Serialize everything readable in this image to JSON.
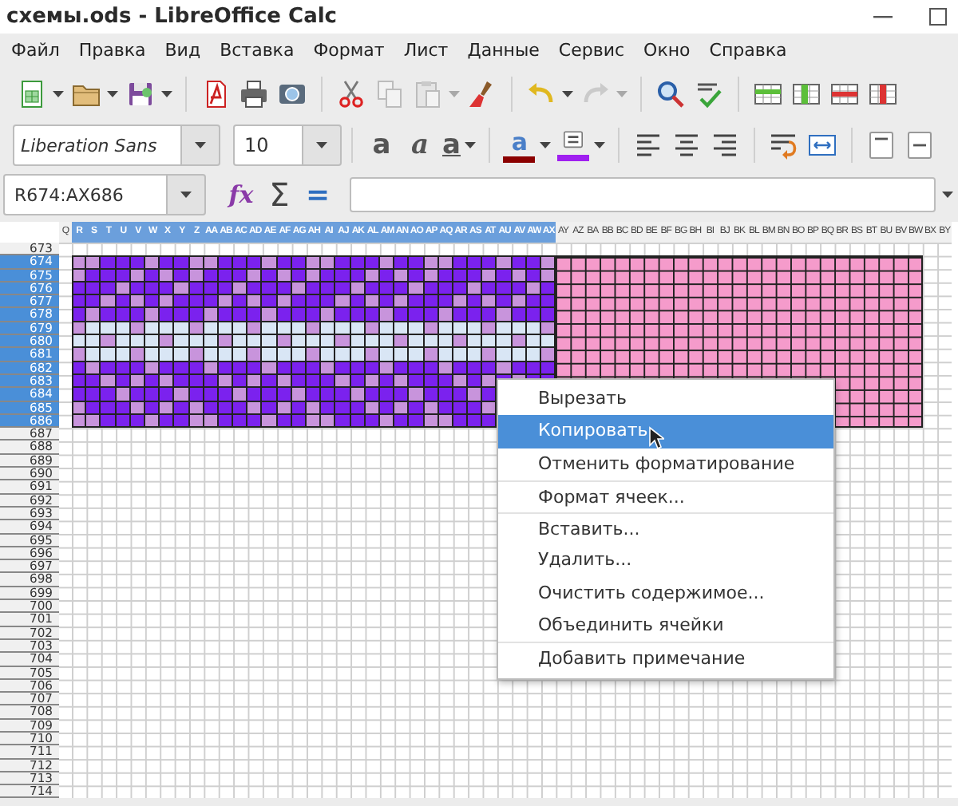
{
  "window": {
    "title": "схемы.ods - LibreOffice Calc"
  },
  "menu": [
    "Файл",
    "Правка",
    "Вид",
    "Вставка",
    "Формат",
    "Лист",
    "Данные",
    "Сервис",
    "Окно",
    "Справка"
  ],
  "standard_toolbar": [
    {
      "kind": "new",
      "disabled": false,
      "dropdown": true,
      "separator_before": false
    },
    {
      "kind": "open",
      "disabled": false,
      "dropdown": true,
      "separator_before": false
    },
    {
      "kind": "save",
      "disabled": false,
      "dropdown": true,
      "separator_before": false
    },
    {
      "kind": "pdf",
      "disabled": false,
      "dropdown": false,
      "separator_before": true
    },
    {
      "kind": "print",
      "disabled": false,
      "dropdown": false,
      "separator_before": false
    },
    {
      "kind": "preview",
      "disabled": false,
      "dropdown": false,
      "separator_before": false
    },
    {
      "kind": "cut",
      "disabled": false,
      "dropdown": false,
      "separator_before": true
    },
    {
      "kind": "copy",
      "disabled": true,
      "dropdown": false,
      "separator_before": false
    },
    {
      "kind": "paste",
      "disabled": true,
      "dropdown": true,
      "separator_before": false
    },
    {
      "kind": "clone",
      "disabled": false,
      "dropdown": false,
      "separator_before": false
    },
    {
      "kind": "undo",
      "disabled": false,
      "dropdown": true,
      "separator_before": true
    },
    {
      "kind": "redo",
      "disabled": true,
      "dropdown": true,
      "separator_before": false
    },
    {
      "kind": "find",
      "disabled": false,
      "dropdown": false,
      "separator_before": true
    },
    {
      "kind": "spelling",
      "disabled": false,
      "dropdown": false,
      "separator_before": false
    },
    {
      "kind": "insert-rows",
      "disabled": false,
      "dropdown": false,
      "separator_before": true
    },
    {
      "kind": "insert-columns",
      "disabled": false,
      "dropdown": false,
      "separator_before": false
    },
    {
      "kind": "delete-rows",
      "disabled": false,
      "dropdown": false,
      "separator_before": false
    },
    {
      "kind": "delete-columns",
      "disabled": false,
      "dropdown": false,
      "separator_before": false
    }
  ],
  "formatting_toolbar": {
    "font_name": "Liberation Sans",
    "font_size": "10",
    "buttons": [
      {
        "kind": "bold",
        "label": "a",
        "dropdown": false,
        "separator_before": true
      },
      {
        "kind": "italic",
        "label": "a",
        "dropdown": false,
        "separator_before": false
      },
      {
        "kind": "underline",
        "label": "a",
        "dropdown": true,
        "separator_before": false
      },
      {
        "kind": "font-color",
        "label": "a",
        "color": "#8b0000",
        "dropdown": true,
        "separator_before": true
      },
      {
        "kind": "highlight",
        "color": "#a020f0",
        "dropdown": true,
        "separator_before": false
      },
      {
        "kind": "align-left",
        "dropdown": false,
        "separator_before": true
      },
      {
        "kind": "align-center",
        "dropdown": false,
        "separator_before": false
      },
      {
        "kind": "align-right",
        "dropdown": false,
        "separator_before": false
      },
      {
        "kind": "wrap",
        "dropdown": false,
        "separator_before": true
      },
      {
        "kind": "merge",
        "dropdown": false,
        "separator_before": false
      },
      {
        "kind": "align-top",
        "dropdown": false,
        "separator_before": true
      },
      {
        "kind": "align-middle",
        "dropdown": false,
        "separator_before": false
      }
    ]
  },
  "formula_bar": {
    "name_box": "R674:AX686",
    "buttons": [
      "fx",
      "Σ",
      "="
    ]
  },
  "sheet": {
    "columns": [
      {
        "label": "Q",
        "selected": false
      },
      {
        "label": "R",
        "selected": true
      },
      {
        "label": "S",
        "selected": true
      },
      {
        "label": "T",
        "selected": true
      },
      {
        "label": "U",
        "selected": true
      },
      {
        "label": "V",
        "selected": true
      },
      {
        "label": "W",
        "selected": true
      },
      {
        "label": "X",
        "selected": true
      },
      {
        "label": "Y",
        "selected": true
      },
      {
        "label": "Z",
        "selected": true
      },
      {
        "label": "AA",
        "selected": true
      },
      {
        "label": "AB",
        "selected": true
      },
      {
        "label": "AC",
        "selected": true
      },
      {
        "label": "AD",
        "selected": true
      },
      {
        "label": "AE",
        "selected": true
      },
      {
        "label": "AF",
        "selected": true
      },
      {
        "label": "AG",
        "selected": true
      },
      {
        "label": "AH",
        "selected": true
      },
      {
        "label": "AI",
        "selected": true
      },
      {
        "label": "AJ",
        "selected": true
      },
      {
        "label": "AK",
        "selected": true
      },
      {
        "label": "AL",
        "selected": true
      },
      {
        "label": "AM",
        "selected": true
      },
      {
        "label": "AN",
        "selected": true
      },
      {
        "label": "AO",
        "selected": true
      },
      {
        "label": "AP",
        "selected": true
      },
      {
        "label": "AQ",
        "selected": true
      },
      {
        "label": "AR",
        "selected": true
      },
      {
        "label": "AS",
        "selected": true
      },
      {
        "label": "AT",
        "selected": true
      },
      {
        "label": "AU",
        "selected": true
      },
      {
        "label": "AV",
        "selected": true
      },
      {
        "label": "AW",
        "selected": true
      },
      {
        "label": "AX",
        "selected": true
      },
      {
        "label": "AY",
        "selected": false
      },
      {
        "label": "AZ",
        "selected": false
      },
      {
        "label": "BA",
        "selected": false
      },
      {
        "label": "BB",
        "selected": false
      },
      {
        "label": "BC",
        "selected": false
      },
      {
        "label": "BD",
        "selected": false
      },
      {
        "label": "BE",
        "selected": false
      },
      {
        "label": "BF",
        "selected": false
      },
      {
        "label": "BG",
        "selected": false
      },
      {
        "label": "BH",
        "selected": false
      },
      {
        "label": "BI",
        "selected": false
      },
      {
        "label": "BJ",
        "selected": false
      },
      {
        "label": "BK",
        "selected": false
      },
      {
        "label": "BL",
        "selected": false
      },
      {
        "label": "BM",
        "selected": false
      },
      {
        "label": "BN",
        "selected": false
      },
      {
        "label": "BO",
        "selected": false
      },
      {
        "label": "BP",
        "selected": false
      },
      {
        "label": "BQ",
        "selected": false
      },
      {
        "label": "BR",
        "selected": false
      },
      {
        "label": "BS",
        "selected": false
      },
      {
        "label": "BT",
        "selected": false
      },
      {
        "label": "BU",
        "selected": false
      },
      {
        "label": "BV",
        "selected": false
      },
      {
        "label": "BW",
        "selected": false
      },
      {
        "label": "BX",
        "selected": false
      },
      {
        "label": "BY",
        "selected": false
      }
    ],
    "rows": [
      {
        "label": "673",
        "selected": false
      },
      {
        "label": "674",
        "selected": true
      },
      {
        "label": "675",
        "selected": true
      },
      {
        "label": "676",
        "selected": true
      },
      {
        "label": "677",
        "selected": true
      },
      {
        "label": "678",
        "selected": true
      },
      {
        "label": "679",
        "selected": true
      },
      {
        "label": "680",
        "selected": true
      },
      {
        "label": "681",
        "selected": true
      },
      {
        "label": "682",
        "selected": true
      },
      {
        "label": "683",
        "selected": true
      },
      {
        "label": "684",
        "selected": true
      },
      {
        "label": "685",
        "selected": true
      },
      {
        "label": "686",
        "selected": true
      },
      {
        "label": "687",
        "selected": false
      },
      {
        "label": "688",
        "selected": false
      },
      {
        "label": "689",
        "selected": false
      },
      {
        "label": "690",
        "selected": false
      },
      {
        "label": "691",
        "selected": false
      },
      {
        "label": "692",
        "selected": false
      },
      {
        "label": "693",
        "selected": false
      },
      {
        "label": "694",
        "selected": false
      },
      {
        "label": "695",
        "selected": false
      },
      {
        "label": "696",
        "selected": false
      },
      {
        "label": "697",
        "selected": false
      },
      {
        "label": "698",
        "selected": false
      },
      {
        "label": "699",
        "selected": false
      },
      {
        "label": "700",
        "selected": false
      },
      {
        "label": "701",
        "selected": false
      },
      {
        "label": "702",
        "selected": false
      },
      {
        "label": "703",
        "selected": false
      },
      {
        "label": "704",
        "selected": false
      },
      {
        "label": "705",
        "selected": false
      },
      {
        "label": "706",
        "selected": false
      },
      {
        "label": "707",
        "selected": false
      },
      {
        "label": "708",
        "selected": false
      },
      {
        "label": "709",
        "selected": false
      },
      {
        "label": "710",
        "selected": false
      },
      {
        "label": "711",
        "selected": false
      },
      {
        "label": "712",
        "selected": false
      },
      {
        "label": "713",
        "selected": false
      },
      {
        "label": "714",
        "selected": false
      }
    ]
  },
  "pattern": {
    "rows": [
      [
        {
          "color": "#c894dc"
        },
        {
          "color": "#c894dc"
        },
        {
          "color": "#7b22ee"
        },
        {
          "color": "#7b22ee"
        },
        {
          "color": "#7b22ee"
        },
        {
          "color": "#c894dc"
        },
        {
          "color": "#7b22ee"
        },
        {
          "color": "#7b22ee"
        },
        {
          "color": "#c894dc"
        },
        {
          "color": "#c894dc"
        },
        {
          "color": "#7b22ee"
        },
        {
          "color": "#7b22ee"
        },
        {
          "color": "#7b22ee"
        },
        {
          "color": "#c894dc"
        },
        {
          "color": "#7b22ee"
        },
        {
          "color": "#7b22ee"
        },
        {
          "color": "#c894dc"
        },
        {
          "color": "#c894dc"
        },
        {
          "color": "#7b22ee"
        },
        {
          "color": "#7b22ee"
        },
        {
          "color": "#7b22ee"
        },
        {
          "color": "#c894dc"
        },
        {
          "color": "#7b22ee"
        },
        {
          "color": "#7b22ee"
        },
        {
          "color": "#c894dc"
        },
        {
          "color": "#c894dc"
        },
        {
          "color": "#7b22ee"
        },
        {
          "color": "#7b22ee"
        },
        {
          "color": "#7b22ee"
        },
        {
          "color": "#c894dc"
        },
        {
          "color": "#7b22ee"
        },
        {
          "color": "#7b22ee"
        },
        {
          "color": "#c894dc"
        }
      ],
      [
        {
          "color": "#c894dc"
        },
        {
          "color": "#7b22ee"
        },
        {
          "color": "#7b22ee"
        },
        {
          "color": "#7b22ee"
        },
        {
          "color": "#c894dc"
        },
        {
          "color": "#7b22ee"
        },
        {
          "color": "#c894dc"
        },
        {
          "color": "#7b22ee"
        },
        {
          "color": "#c894dc"
        },
        {
          "color": "#7b22ee"
        },
        {
          "color": "#7b22ee"
        },
        {
          "color": "#7b22ee"
        },
        {
          "color": "#c894dc"
        },
        {
          "color": "#7b22ee"
        },
        {
          "color": "#c894dc"
        },
        {
          "color": "#7b22ee"
        },
        {
          "color": "#c894dc"
        },
        {
          "color": "#7b22ee"
        },
        {
          "color": "#7b22ee"
        },
        {
          "color": "#7b22ee"
        },
        {
          "color": "#c894dc"
        },
        {
          "color": "#7b22ee"
        },
        {
          "color": "#c894dc"
        },
        {
          "color": "#7b22ee"
        },
        {
          "color": "#c894dc"
        },
        {
          "color": "#7b22ee"
        },
        {
          "color": "#7b22ee"
        },
        {
          "color": "#7b22ee"
        },
        {
          "color": "#c894dc"
        },
        {
          "color": "#7b22ee"
        },
        {
          "color": "#c894dc"
        },
        {
          "color": "#7b22ee"
        },
        {
          "color": "#c894dc"
        }
      ],
      [
        {
          "color": "#7b22ee"
        },
        {
          "color": "#7b22ee"
        },
        {
          "color": "#7b22ee"
        },
        {
          "color": "#c894dc"
        },
        {
          "color": "#7b22ee"
        },
        {
          "color": "#7b22ee"
        },
        {
          "color": "#7b22ee"
        },
        {
          "color": "#c894dc"
        },
        {
          "color": "#7b22ee"
        },
        {
          "color": "#7b22ee"
        },
        {
          "color": "#7b22ee"
        },
        {
          "color": "#c894dc"
        },
        {
          "color": "#7b22ee"
        },
        {
          "color": "#7b22ee"
        },
        {
          "color": "#7b22ee"
        },
        {
          "color": "#c894dc"
        },
        {
          "color": "#7b22ee"
        },
        {
          "color": "#7b22ee"
        },
        {
          "color": "#7b22ee"
        },
        {
          "color": "#c894dc"
        },
        {
          "color": "#7b22ee"
        },
        {
          "color": "#7b22ee"
        },
        {
          "color": "#7b22ee"
        },
        {
          "color": "#c894dc"
        },
        {
          "color": "#7b22ee"
        },
        {
          "color": "#7b22ee"
        },
        {
          "color": "#7b22ee"
        },
        {
          "color": "#c894dc"
        },
        {
          "color": "#7b22ee"
        },
        {
          "color": "#7b22ee"
        },
        {
          "color": "#7b22ee"
        },
        {
          "color": "#c894dc"
        },
        {
          "color": "#7b22ee"
        }
      ],
      [
        {
          "color": "#7b22ee"
        },
        {
          "color": "#7b22ee"
        },
        {
          "color": "#c894dc"
        },
        {
          "color": "#7b22ee"
        },
        {
          "color": "#c894dc"
        },
        {
          "color": "#7b22ee"
        },
        {
          "color": "#c894dc"
        },
        {
          "color": "#7b22ee"
        },
        {
          "color": "#7b22ee"
        },
        {
          "color": "#7b22ee"
        },
        {
          "color": "#c894dc"
        },
        {
          "color": "#7b22ee"
        },
        {
          "color": "#c894dc"
        },
        {
          "color": "#7b22ee"
        },
        {
          "color": "#c894dc"
        },
        {
          "color": "#7b22ee"
        },
        {
          "color": "#7b22ee"
        },
        {
          "color": "#7b22ee"
        },
        {
          "color": "#c894dc"
        },
        {
          "color": "#7b22ee"
        },
        {
          "color": "#c894dc"
        },
        {
          "color": "#7b22ee"
        },
        {
          "color": "#c894dc"
        },
        {
          "color": "#7b22ee"
        },
        {
          "color": "#7b22ee"
        },
        {
          "color": "#7b22ee"
        },
        {
          "color": "#c894dc"
        },
        {
          "color": "#7b22ee"
        },
        {
          "color": "#c894dc"
        },
        {
          "color": "#7b22ee"
        },
        {
          "color": "#c894dc"
        },
        {
          "color": "#7b22ee"
        },
        {
          "color": "#7b22ee"
        }
      ],
      [
        {
          "color": "#7b22ee"
        },
        {
          "color": "#c894dc"
        },
        {
          "color": "#7b22ee"
        },
        {
          "color": "#7b22ee"
        },
        {
          "color": "#7b22ee"
        },
        {
          "color": "#c894dc"
        },
        {
          "color": "#7b22ee"
        },
        {
          "color": "#7b22ee"
        },
        {
          "color": "#7b22ee"
        },
        {
          "color": "#c894dc"
        },
        {
          "color": "#7b22ee"
        },
        {
          "color": "#7b22ee"
        },
        {
          "color": "#7b22ee"
        },
        {
          "color": "#c894dc"
        },
        {
          "color": "#7b22ee"
        },
        {
          "color": "#7b22ee"
        },
        {
          "color": "#7b22ee"
        },
        {
          "color": "#c894dc"
        },
        {
          "color": "#7b22ee"
        },
        {
          "color": "#7b22ee"
        },
        {
          "color": "#7b22ee"
        },
        {
          "color": "#c894dc"
        },
        {
          "color": "#7b22ee"
        },
        {
          "color": "#7b22ee"
        },
        {
          "color": "#7b22ee"
        },
        {
          "color": "#c894dc"
        },
        {
          "color": "#7b22ee"
        },
        {
          "color": "#7b22ee"
        },
        {
          "color": "#7b22ee"
        },
        {
          "color": "#c894dc"
        },
        {
          "color": "#7b22ee"
        },
        {
          "color": "#7b22ee"
        },
        {
          "color": "#7b22ee"
        }
      ],
      [
        {
          "color": "#c894dc"
        },
        {
          "color": "#d9e6f5"
        },
        {
          "color": "#d9e6f5"
        },
        {
          "color": "#d9e6f5"
        },
        {
          "color": "#c894dc"
        },
        {
          "color": "#d9e6f5"
        },
        {
          "color": "#d9e6f5"
        },
        {
          "color": "#d9e6f5"
        },
        {
          "color": "#c894dc"
        },
        {
          "color": "#d9e6f5"
        },
        {
          "color": "#d9e6f5"
        },
        {
          "color": "#d9e6f5"
        },
        {
          "color": "#c894dc"
        },
        {
          "color": "#d9e6f5"
        },
        {
          "color": "#d9e6f5"
        },
        {
          "color": "#d9e6f5"
        },
        {
          "color": "#c894dc"
        },
        {
          "color": "#d9e6f5"
        },
        {
          "color": "#d9e6f5"
        },
        {
          "color": "#d9e6f5"
        },
        {
          "color": "#c894dc"
        },
        {
          "color": "#d9e6f5"
        },
        {
          "color": "#d9e6f5"
        },
        {
          "color": "#d9e6f5"
        },
        {
          "color": "#c894dc"
        },
        {
          "color": "#d9e6f5"
        },
        {
          "color": "#d9e6f5"
        },
        {
          "color": "#d9e6f5"
        },
        {
          "color": "#c894dc"
        },
        {
          "color": "#d9e6f5"
        },
        {
          "color": "#d9e6f5"
        },
        {
          "color": "#d9e6f5"
        },
        {
          "color": "#c894dc"
        }
      ],
      [
        {
          "color": "#d9e6f5"
        },
        {
          "color": "#d9e6f5"
        },
        {
          "color": "#c894dc"
        },
        {
          "color": "#d9e6f5"
        },
        {
          "color": "#d9e6f5"
        },
        {
          "color": "#d9e6f5"
        },
        {
          "color": "#c894dc"
        },
        {
          "color": "#d9e6f5"
        },
        {
          "color": "#d9e6f5"
        },
        {
          "color": "#d9e6f5"
        },
        {
          "color": "#c894dc"
        },
        {
          "color": "#d9e6f5"
        },
        {
          "color": "#d9e6f5"
        },
        {
          "color": "#d9e6f5"
        },
        {
          "color": "#c894dc"
        },
        {
          "color": "#d9e6f5"
        },
        {
          "color": "#d9e6f5"
        },
        {
          "color": "#d9e6f5"
        },
        {
          "color": "#c894dc"
        },
        {
          "color": "#d9e6f5"
        },
        {
          "color": "#d9e6f5"
        },
        {
          "color": "#d9e6f5"
        },
        {
          "color": "#c894dc"
        },
        {
          "color": "#d9e6f5"
        },
        {
          "color": "#d9e6f5"
        },
        {
          "color": "#d9e6f5"
        },
        {
          "color": "#c894dc"
        },
        {
          "color": "#d9e6f5"
        },
        {
          "color": "#d9e6f5"
        },
        {
          "color": "#d9e6f5"
        },
        {
          "color": "#c894dc"
        },
        {
          "color": "#d9e6f5"
        },
        {
          "color": "#d9e6f5"
        }
      ],
      [
        {
          "color": "#c894dc"
        },
        {
          "color": "#d9e6f5"
        },
        {
          "color": "#d9e6f5"
        },
        {
          "color": "#d9e6f5"
        },
        {
          "color": "#c894dc"
        },
        {
          "color": "#d9e6f5"
        },
        {
          "color": "#d9e6f5"
        },
        {
          "color": "#d9e6f5"
        },
        {
          "color": "#c894dc"
        },
        {
          "color": "#d9e6f5"
        },
        {
          "color": "#d9e6f5"
        },
        {
          "color": "#d9e6f5"
        },
        {
          "color": "#c894dc"
        },
        {
          "color": "#d9e6f5"
        },
        {
          "color": "#d9e6f5"
        },
        {
          "color": "#d9e6f5"
        },
        {
          "color": "#c894dc"
        },
        {
          "color": "#d9e6f5"
        },
        {
          "color": "#d9e6f5"
        },
        {
          "color": "#d9e6f5"
        },
        {
          "color": "#c894dc"
        },
        {
          "color": "#d9e6f5"
        },
        {
          "color": "#d9e6f5"
        },
        {
          "color": "#d9e6f5"
        },
        {
          "color": "#c894dc"
        },
        {
          "color": "#d9e6f5"
        },
        {
          "color": "#d9e6f5"
        },
        {
          "color": "#d9e6f5"
        },
        {
          "color": "#c894dc"
        },
        {
          "color": "#d9e6f5"
        },
        {
          "color": "#d9e6f5"
        },
        {
          "color": "#d9e6f5"
        },
        {
          "color": "#c894dc"
        }
      ],
      [
        {
          "color": "#7b22ee"
        },
        {
          "color": "#c894dc"
        },
        {
          "color": "#7b22ee"
        },
        {
          "color": "#7b22ee"
        },
        {
          "color": "#7b22ee"
        },
        {
          "color": "#c894dc"
        },
        {
          "color": "#7b22ee"
        },
        {
          "color": "#7b22ee"
        },
        {
          "color": "#7b22ee"
        },
        {
          "color": "#c894dc"
        },
        {
          "color": "#7b22ee"
        },
        {
          "color": "#7b22ee"
        },
        {
          "color": "#7b22ee"
        },
        {
          "color": "#c894dc"
        },
        {
          "color": "#7b22ee"
        },
        {
          "color": "#7b22ee"
        },
        {
          "color": "#7b22ee"
        },
        {
          "color": "#c894dc"
        },
        {
          "color": "#7b22ee"
        },
        {
          "color": "#7b22ee"
        },
        {
          "color": "#7b22ee"
        },
        {
          "color": "#c894dc"
        },
        {
          "color": "#7b22ee"
        },
        {
          "color": "#7b22ee"
        },
        {
          "color": "#7b22ee"
        },
        {
          "color": "#c894dc"
        },
        {
          "color": "#7b22ee"
        },
        {
          "color": "#7b22ee"
        },
        {
          "color": "#7b22ee"
        },
        {
          "color": "#c894dc"
        },
        {
          "color": "#7b22ee"
        },
        {
          "color": "#7b22ee"
        },
        {
          "color": "#7b22ee"
        }
      ],
      [
        {
          "color": "#7b22ee"
        },
        {
          "color": "#7b22ee"
        },
        {
          "color": "#c894dc"
        },
        {
          "color": "#7b22ee"
        },
        {
          "color": "#c894dc"
        },
        {
          "color": "#7b22ee"
        },
        {
          "color": "#c894dc"
        },
        {
          "color": "#7b22ee"
        },
        {
          "color": "#7b22ee"
        },
        {
          "color": "#7b22ee"
        },
        {
          "color": "#c894dc"
        },
        {
          "color": "#7b22ee"
        },
        {
          "color": "#c894dc"
        },
        {
          "color": "#7b22ee"
        },
        {
          "color": "#c894dc"
        },
        {
          "color": "#7b22ee"
        },
        {
          "color": "#7b22ee"
        },
        {
          "color": "#7b22ee"
        },
        {
          "color": "#c894dc"
        },
        {
          "color": "#7b22ee"
        },
        {
          "color": "#c894dc"
        },
        {
          "color": "#7b22ee"
        },
        {
          "color": "#c894dc"
        },
        {
          "color": "#7b22ee"
        },
        {
          "color": "#7b22ee"
        },
        {
          "color": "#7b22ee"
        },
        {
          "color": "#c894dc"
        },
        {
          "color": "#7b22ee"
        },
        {
          "color": "#c894dc"
        },
        {
          "color": "#7b22ee"
        },
        {
          "color": "#c894dc"
        },
        {
          "color": "#7b22ee"
        },
        {
          "color": "#7b22ee"
        }
      ],
      [
        {
          "color": "#7b22ee"
        },
        {
          "color": "#7b22ee"
        },
        {
          "color": "#7b22ee"
        },
        {
          "color": "#c894dc"
        },
        {
          "color": "#7b22ee"
        },
        {
          "color": "#7b22ee"
        },
        {
          "color": "#7b22ee"
        },
        {
          "color": "#c894dc"
        },
        {
          "color": "#7b22ee"
        },
        {
          "color": "#7b22ee"
        },
        {
          "color": "#7b22ee"
        },
        {
          "color": "#c894dc"
        },
        {
          "color": "#7b22ee"
        },
        {
          "color": "#7b22ee"
        },
        {
          "color": "#7b22ee"
        },
        {
          "color": "#c894dc"
        },
        {
          "color": "#7b22ee"
        },
        {
          "color": "#7b22ee"
        },
        {
          "color": "#7b22ee"
        },
        {
          "color": "#c894dc"
        },
        {
          "color": "#7b22ee"
        },
        {
          "color": "#7b22ee"
        },
        {
          "color": "#7b22ee"
        },
        {
          "color": "#c894dc"
        },
        {
          "color": "#7b22ee"
        },
        {
          "color": "#7b22ee"
        },
        {
          "color": "#7b22ee"
        },
        {
          "color": "#c894dc"
        },
        {
          "color": "#7b22ee"
        }
      ],
      [
        {
          "color": "#c894dc"
        },
        {
          "color": "#7b22ee"
        },
        {
          "color": "#7b22ee"
        },
        {
          "color": "#7b22ee"
        },
        {
          "color": "#c894dc"
        },
        {
          "color": "#7b22ee"
        },
        {
          "color": "#c894dc"
        },
        {
          "color": "#7b22ee"
        },
        {
          "color": "#c894dc"
        },
        {
          "color": "#7b22ee"
        },
        {
          "color": "#7b22ee"
        },
        {
          "color": "#7b22ee"
        },
        {
          "color": "#c894dc"
        },
        {
          "color": "#7b22ee"
        },
        {
          "color": "#c894dc"
        },
        {
          "color": "#7b22ee"
        },
        {
          "color": "#c894dc"
        },
        {
          "color": "#7b22ee"
        },
        {
          "color": "#7b22ee"
        },
        {
          "color": "#7b22ee"
        },
        {
          "color": "#c894dc"
        },
        {
          "color": "#7b22ee"
        },
        {
          "color": "#c894dc"
        },
        {
          "color": "#7b22ee"
        },
        {
          "color": "#c894dc"
        },
        {
          "color": "#7b22ee"
        },
        {
          "color": "#7b22ee"
        },
        {
          "color": "#7b22ee"
        },
        {
          "color": "#c894dc"
        }
      ],
      [
        {
          "color": "#c894dc"
        },
        {
          "color": "#c894dc"
        },
        {
          "color": "#7b22ee"
        },
        {
          "color": "#7b22ee"
        },
        {
          "color": "#7b22ee"
        },
        {
          "color": "#c894dc"
        },
        {
          "color": "#7b22ee"
        },
        {
          "color": "#7b22ee"
        },
        {
          "color": "#c894dc"
        },
        {
          "color": "#c894dc"
        },
        {
          "color": "#7b22ee"
        },
        {
          "color": "#7b22ee"
        },
        {
          "color": "#7b22ee"
        },
        {
          "color": "#c894dc"
        },
        {
          "color": "#7b22ee"
        },
        {
          "color": "#7b22ee"
        },
        {
          "color": "#c894dc"
        },
        {
          "color": "#c894dc"
        },
        {
          "color": "#7b22ee"
        },
        {
          "color": "#7b22ee"
        },
        {
          "color": "#7b22ee"
        },
        {
          "color": "#c894dc"
        },
        {
          "color": "#7b22ee"
        },
        {
          "color": "#7b22ee"
        },
        {
          "color": "#c894dc"
        },
        {
          "color": "#c894dc"
        },
        {
          "color": "#7b22ee"
        },
        {
          "color": "#7b22ee"
        },
        {
          "color": "#7b22ee"
        }
      ]
    ]
  },
  "fill_block": {
    "color": "#f59bcb"
  },
  "context_menu": [
    {
      "label": "Вырезать",
      "selected": false,
      "separator_before": false
    },
    {
      "label": "Копировать",
      "selected": true,
      "separator_before": false
    },
    {
      "label": "Отменить форматирование",
      "selected": false,
      "separator_before": false
    },
    {
      "label": "Формат ячеек...",
      "selected": false,
      "separator_before": true
    },
    {
      "label": "Вставить...",
      "selected": false,
      "separator_before": true
    },
    {
      "label": "Удалить...",
      "selected": false,
      "separator_before": false
    },
    {
      "label": "Очистить содержимое...",
      "selected": false,
      "separator_before": false
    },
    {
      "label": "Объединить ячейки",
      "selected": false,
      "separator_before": false
    },
    {
      "label": "Добавить примечание",
      "selected": false,
      "separator_before": true
    }
  ]
}
